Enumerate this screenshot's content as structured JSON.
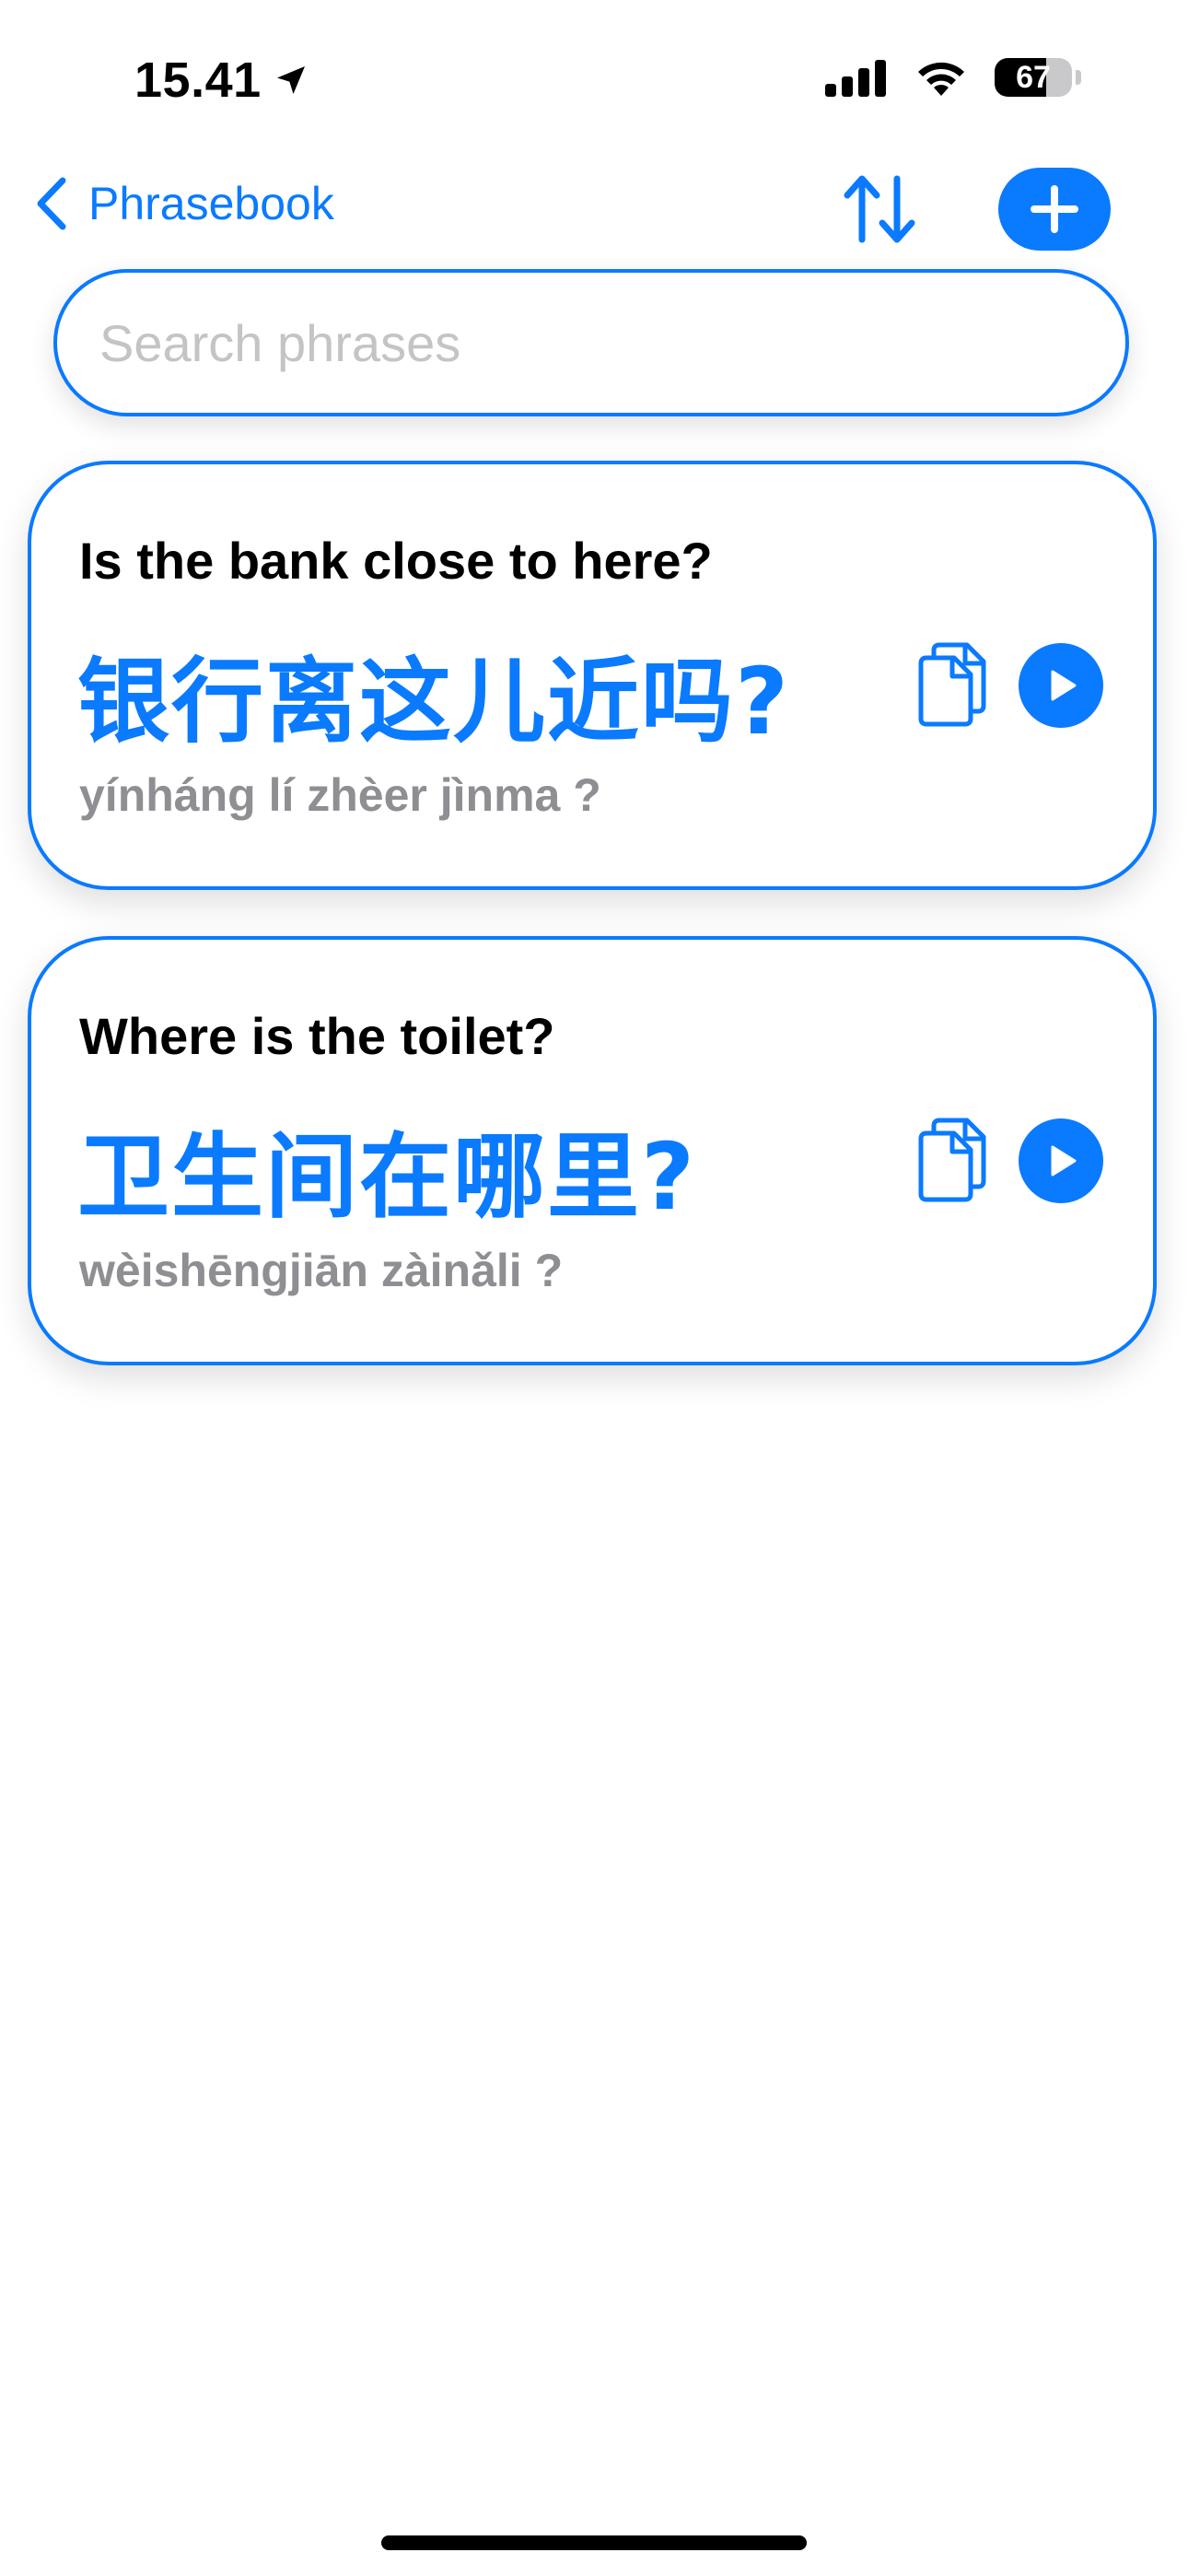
{
  "status_bar": {
    "time": "15.41",
    "battery_level": "67",
    "battery_fraction": 0.67,
    "icons": [
      "location-arrow-icon",
      "cellular-signal-icon",
      "wifi-icon",
      "battery-icon"
    ]
  },
  "nav": {
    "back_label": "Phrasebook",
    "back_icon": "chevron-left-icon",
    "sort_icon": "swap-vertical-icon",
    "add_icon": "plus-icon"
  },
  "search": {
    "placeholder": "Search phrases",
    "value": ""
  },
  "phrases": [
    {
      "english": "Is the bank close to here?",
      "chinese": "银行离这儿近吗?",
      "pinyin": "yínháng lí zhèer jìnma ?"
    },
    {
      "english": "Where is the toilet?",
      "chinese": "卫生间在哪里?",
      "pinyin": "wèishēngjiān zàinǎli ?"
    }
  ],
  "colors": {
    "accent": "#0a7aff",
    "secondary_text": "#8e8e93",
    "placeholder": "#c4c4c7"
  }
}
